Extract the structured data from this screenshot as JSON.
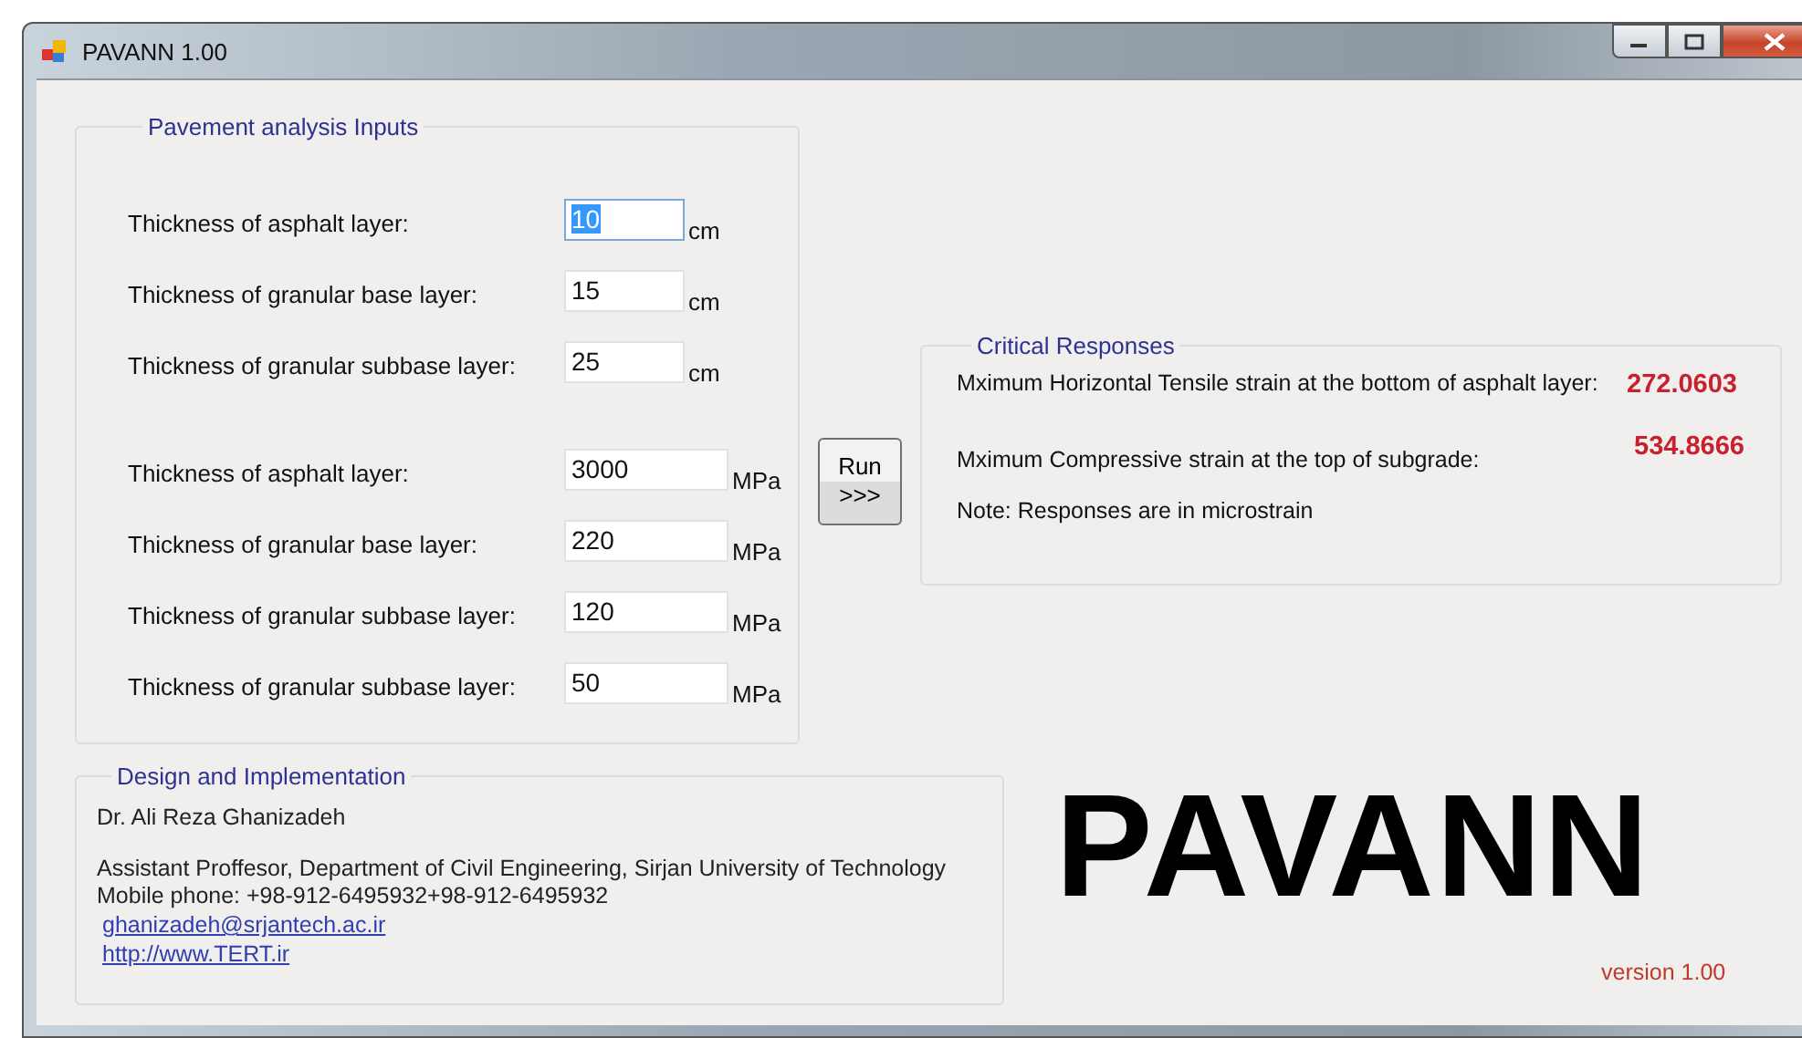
{
  "window": {
    "title": "PAVANN 1.00"
  },
  "inputs": {
    "title": "Pavement analysis Inputs",
    "sections": [
      {
        "rows": [
          {
            "label": "Thickness of asphalt layer:",
            "value": "10",
            "unit": "cm",
            "highlighted": true
          },
          {
            "label": "Thickness of granular base layer:",
            "value": "15",
            "unit": "cm",
            "highlighted": false
          },
          {
            "label": "Thickness of granular subbase layer:",
            "value": "25",
            "unit": "cm",
            "highlighted": false
          }
        ]
      },
      {
        "rows": [
          {
            "label": "Thickness of asphalt layer:",
            "value": "3000",
            "unit": "MPa",
            "highlighted": false
          },
          {
            "label": "Thickness of granular base layer:",
            "value": "220",
            "unit": "MPa",
            "highlighted": false
          },
          {
            "label": "Thickness of granular subbase layer:",
            "value": "120",
            "unit": "MPa",
            "highlighted": false
          },
          {
            "label": "Thickness of granular subbase layer:",
            "value": "50",
            "unit": "MPa",
            "highlighted": false
          }
        ]
      }
    ]
  },
  "run_button": {
    "line_1": "Run",
    "line_2": ">>>"
  },
  "responses": {
    "title": "Critical Responses",
    "items": [
      {
        "label": "Mximum Horizontal Tensile strain at the bottom of asphalt layer:",
        "value": "272.0603"
      },
      {
        "label": "Mximum Compressive strain at the top of subgrade:",
        "value": "534.8666"
      }
    ],
    "note": "Note: Responses are in microstrain"
  },
  "design": {
    "title": "Design and Implementation",
    "name": "Dr.  Ali Reza Ghanizadeh",
    "position": "Assistant Proffesor, Department of Civil Engineering, Sirjan University of Technology",
    "phone": "Mobile phone: +98-912-6495932+98-912-6495932",
    "email": "ghanizadeh@srjantech.ac.ir",
    "website": "http://www.TERT.ir"
  },
  "logo": {
    "text": "PAVANN",
    "version": "version 1.00"
  }
}
